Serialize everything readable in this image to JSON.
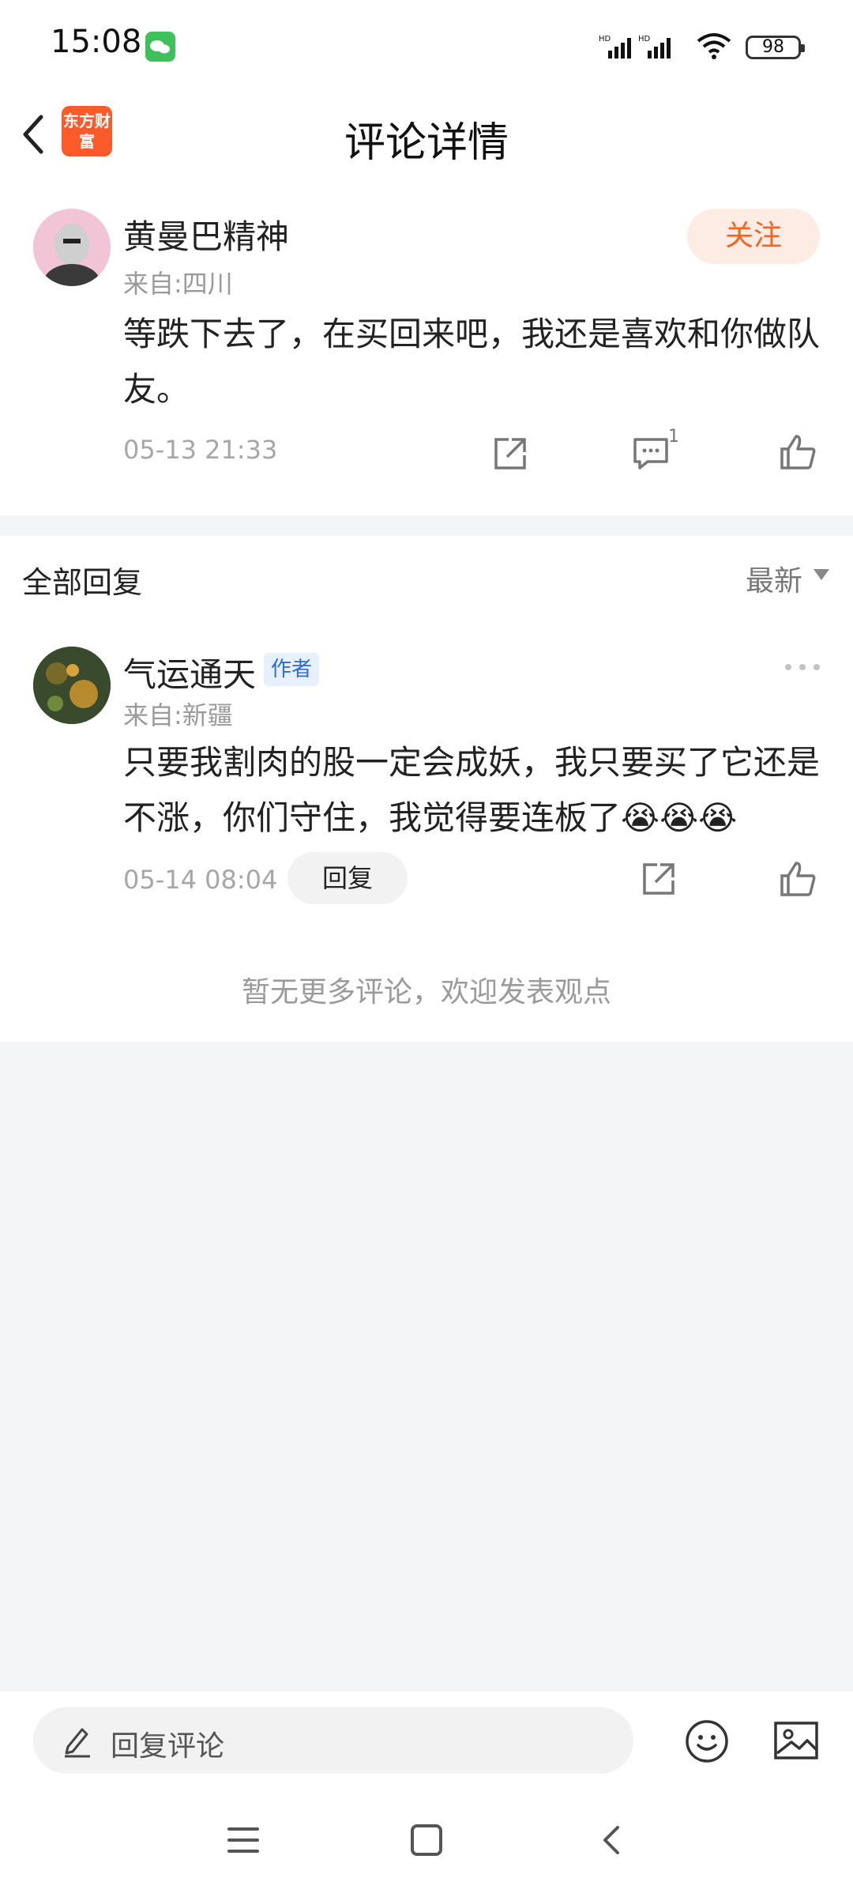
{
  "status_bar": {
    "time": "15:08",
    "battery": "98"
  },
  "header": {
    "title": "评论详情",
    "logo_text": "东方财富"
  },
  "top_comment": {
    "author": "黄曼巴精神",
    "location": "来自:四川",
    "follow_label": "关注",
    "content": "等跌下去了，在买回来吧，我还是喜欢和你做队友。",
    "timestamp": "05-13 21:33",
    "comment_count": "1"
  },
  "replies": {
    "title": "全部回复",
    "sort_label": "最新",
    "items": [
      {
        "author": "气运通天",
        "badge": "作者",
        "location": "来自:新疆",
        "content": "只要我割肉的股一定会成妖，我只要买了它还是不涨，你们守住，我觉得要连板了😭😭😭",
        "timestamp": "05-14 08:04",
        "reply_label": "回复"
      }
    ],
    "no_more_text": "暂无更多评论，欢迎发表观点"
  },
  "bottom_bar": {
    "input_placeholder": "回复评论"
  },
  "colors": {
    "accent": "#f2641f",
    "brand": "#ff5a2a",
    "author_badge": "#2f6bd7"
  }
}
